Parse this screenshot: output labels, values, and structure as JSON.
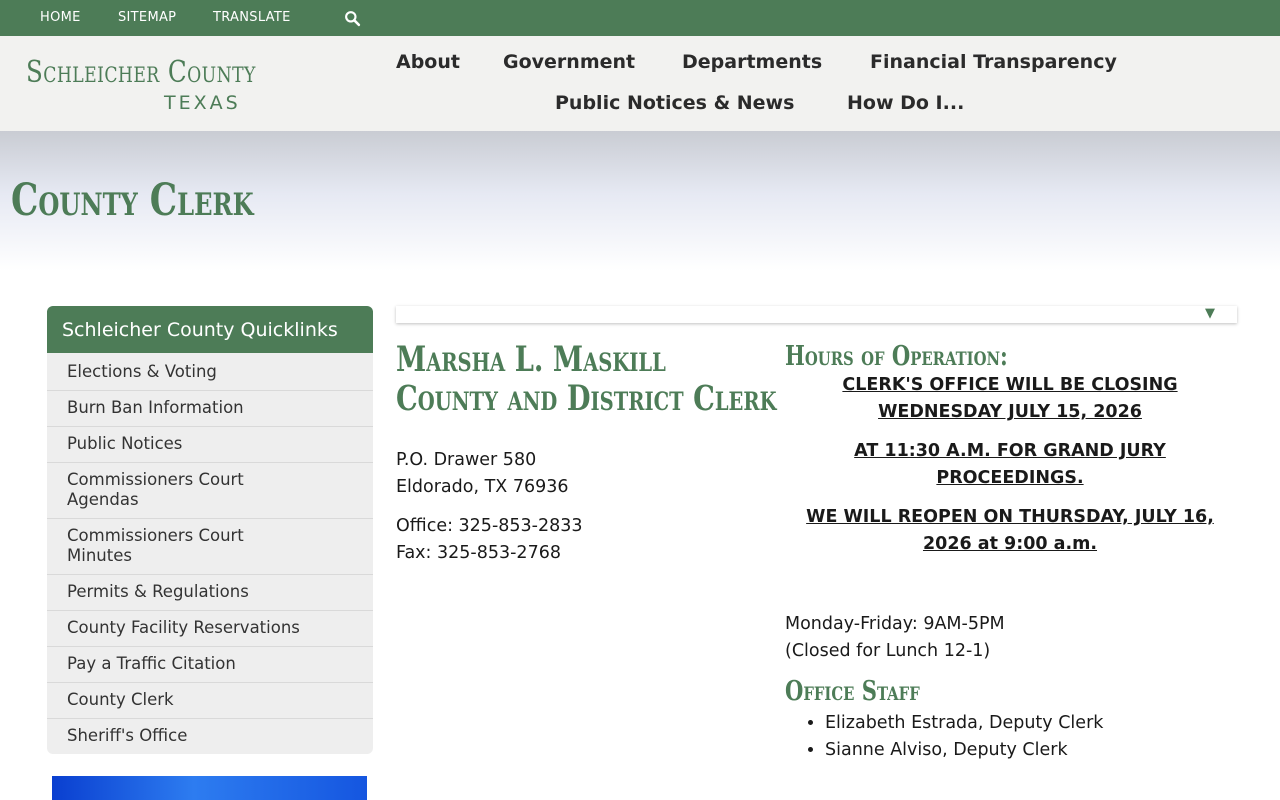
{
  "topbar": {
    "links": [
      "HOME",
      "SITEMAP",
      "TRANSLATE"
    ],
    "search_icon": "search-icon"
  },
  "logo": {
    "main": "Schleicher County",
    "sub": "TEXAS"
  },
  "nav": {
    "items": [
      "About",
      "Government",
      "Departments",
      "Financial Transparency",
      "Public Notices & News",
      "How Do I..."
    ]
  },
  "page": {
    "title": "County Clerk"
  },
  "sidebar": {
    "heading": "Schleicher County Quicklinks",
    "items": [
      "Elections & Voting",
      "Burn Ban Information",
      "Public Notices",
      "Commissioners Court Agendas",
      "Commissioners Court Minutes",
      "Permits & Regulations",
      "County Facility Reservations",
      "Pay a Traffic Citation",
      "County Clerk",
      "Sheriff's Office"
    ]
  },
  "content": {
    "collapse_icon": "▼",
    "clerk_name": "Marsha L. Maskill",
    "clerk_title": "County and District Clerk",
    "address_line1": "P.O. Drawer 580",
    "address_line2": "Eldorado, TX 76936",
    "office_phone": "Office: 325-853-2833",
    "fax": "Fax: 325-853-2768",
    "hours_heading": "Hours of Operation:",
    "notices": [
      "CLERK'S OFFICE WILL BE CLOSING WEDNESDAY JULY 15, 2026",
      "AT 11:30 A.M. FOR GRAND JURY PROCEEDINGS.",
      "WE WILL REOPEN ON THURSDAY, JULY 16, 2026 at 9:00 a.m."
    ],
    "hours_line1": "Monday-Friday: 9AM-5PM",
    "hours_line2": "(Closed for Lunch 12-1)",
    "staff_heading": "Office Staff",
    "staff": [
      "Elizabeth Estrada, Deputy Clerk",
      "Sianne Alviso, Deputy Clerk"
    ]
  },
  "colors": {
    "brand_green": "#4d7c57",
    "header_bg": "#f2f2f0",
    "sidebar_bg": "#eeeeee"
  }
}
